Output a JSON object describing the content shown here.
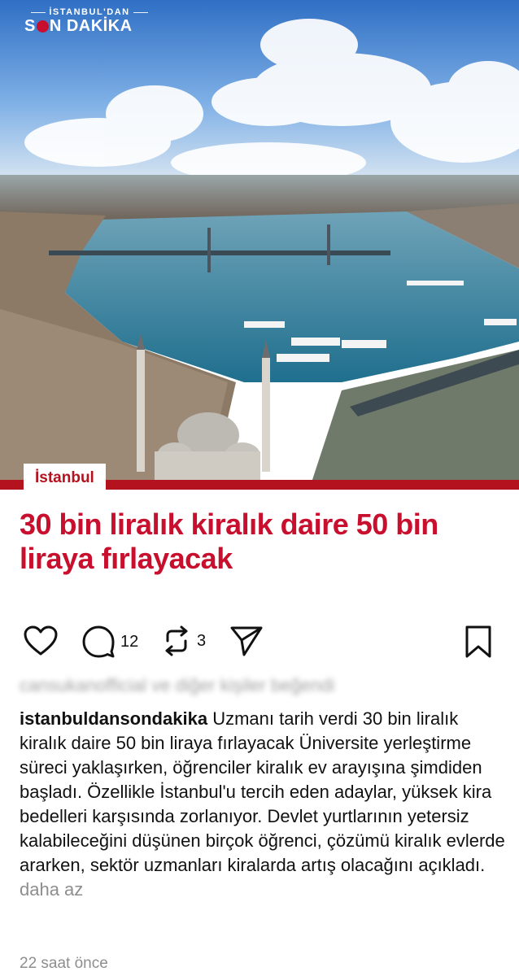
{
  "post": {
    "brand": {
      "top": "İSTANBUL'DAN",
      "bottom_a": "S",
      "bottom_b": "N DAKİKA"
    },
    "category_tag": "İstanbul",
    "headline": "30 bin liralık kiralık daire 50 bin liraya fırlayacak",
    "brand_color": "#c8102e"
  },
  "actions": {
    "like_icon": "heart-icon",
    "comment_icon": "comment-icon",
    "comment_count": "12",
    "repost_icon": "repost-icon",
    "repost_count": "3",
    "share_icon": "send-icon",
    "save_icon": "bookmark-icon"
  },
  "caption": {
    "liked_by": "cansukanofficial ve diğer kişiler beğendi",
    "username": "istanbuldansondakika",
    "text": "Uzmanı tarih verdi 30 bin liralık kiralık daire 50 bin liraya fırlayacak Üniversite yerleştirme süreci yaklaşırken, öğrenciler kiralık ev arayışına şimdiden başladı. Özellikle İstanbul'u tercih eden adaylar, yüksek kira bedelleri karşısında zorlanıyor. Devlet yurtlarının yetersiz kalabileceğini düşünen birçok öğrenci, çözümü kiralık evlerde ararken, sektör uzmanları kiralarda artış olacağını açıkladı.",
    "more_label": "daha az",
    "timestamp": "22 saat önce"
  }
}
